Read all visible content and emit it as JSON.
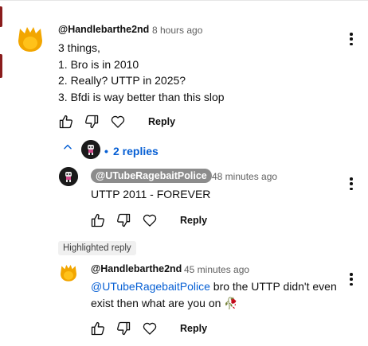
{
  "comment": {
    "author": "@Handlebarthe2nd",
    "time": "8 hours ago",
    "lines": [
      "3 things,",
      "1. Bro is in 2010",
      "2. Really? UTTP in 2025?",
      "3. Bfdi is way better than this slop"
    ],
    "reply_label": "Reply",
    "avatar_icon": "flame-avatar-icon",
    "avatar_color": "#f2a600"
  },
  "replies_toggle": {
    "label": "2 replies",
    "bullet": "•",
    "icon": "chevron-up-icon"
  },
  "reply1": {
    "author": "@UTubeRagebaitPolice",
    "time": "48 minutes ago",
    "text": "UTTP 2011 - FOREVER",
    "reply_label": "Reply",
    "avatar_icon": "dark-mascot-avatar-icon"
  },
  "highlighted_label": "Highlighted reply",
  "reply2": {
    "author": "@Handlebarthe2nd",
    "time": "45 minutes ago",
    "mention": "@UTubeRagebaitPolice",
    "text_line1": " bro the UTTP didn't even",
    "text_line2": "exist then what are you on",
    "emoji": "🥀",
    "reply_label": "Reply"
  },
  "colors": {
    "link": "#065fd4",
    "chip_bg": "#8c8c8c",
    "edge_accent": "#8a1c1c"
  }
}
